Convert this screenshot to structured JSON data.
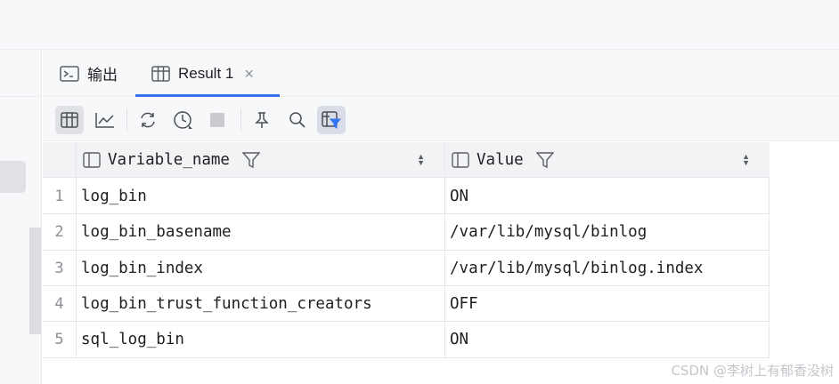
{
  "tabs": {
    "output_label": "输出",
    "result_label": "Result 1",
    "close_glyph": "×"
  },
  "toolbar": {
    "icons": [
      "table-view-icon",
      "chart-view-icon",
      "refresh-icon",
      "history-icon",
      "stop-icon",
      "pin-icon",
      "search-icon",
      "filter-panel-icon"
    ]
  },
  "table": {
    "columns": [
      {
        "name": "Variable_name"
      },
      {
        "name": "Value"
      }
    ],
    "rows": [
      {
        "num": "1",
        "variable_name": "log_bin",
        "value": "ON"
      },
      {
        "num": "2",
        "variable_name": "log_bin_basename",
        "value": "/var/lib/mysql/binlog"
      },
      {
        "num": "3",
        "variable_name": "log_bin_index",
        "value": "/var/lib/mysql/binlog.index"
      },
      {
        "num": "4",
        "variable_name": "log_bin_trust_function_creators",
        "value": "OFF"
      },
      {
        "num": "5",
        "variable_name": "sql_log_bin",
        "value": "ON"
      }
    ]
  },
  "watermark": "CSDN @李树上有郁香没树",
  "colors": {
    "accent": "#3574f0",
    "panel_bg": "#f7f8fa",
    "header_bg": "#f2f3f5"
  }
}
